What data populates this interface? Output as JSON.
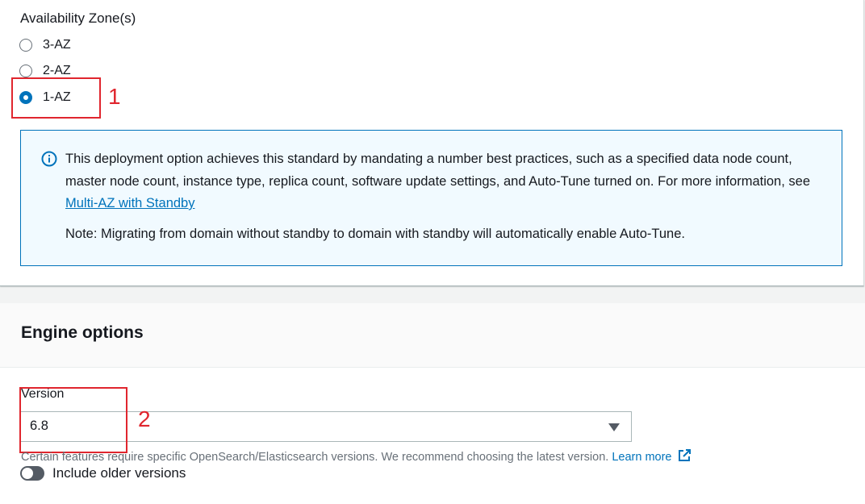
{
  "availability": {
    "label": "Availability Zone(s)",
    "options": [
      {
        "label": "3-AZ",
        "selected": false
      },
      {
        "label": "2-AZ",
        "selected": false
      },
      {
        "label": "1-AZ",
        "selected": true
      }
    ]
  },
  "annotations": {
    "one": "1",
    "two": "2",
    "color": "#e0262e"
  },
  "info": {
    "icon": "info-icon",
    "text_before_link": "This deployment option achieves this standard by mandating a number best practices, such as a specified data node count, master node count, instance type, replica count, software update settings, and Auto-Tune turned on. For more information, see ",
    "link_text": "Multi-AZ with Standby",
    "note": "Note: Migrating from domain without standby to domain with standby will automatically enable Auto-Tune."
  },
  "engine": {
    "title": "Engine options",
    "version_label": "Version",
    "version_value": "6.8",
    "hint_text": "Certain features require specific OpenSearch/Elasticsearch versions. We recommend choosing the latest version.",
    "learn_more": "Learn more",
    "toggle_label": "Include older versions",
    "toggle_on": false
  },
  "colors": {
    "accent": "#0073bb",
    "info_bg": "#f1faff",
    "annotation": "#e0262e"
  }
}
